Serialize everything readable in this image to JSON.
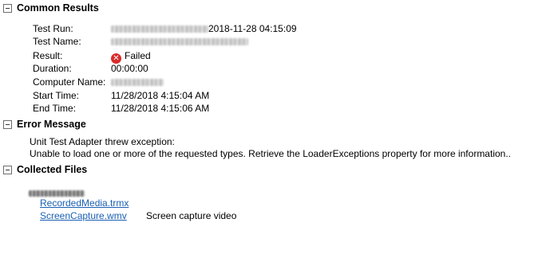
{
  "sections": {
    "common_results": "Common Results",
    "error_message": "Error Message",
    "collected_files": "Collected Files"
  },
  "common": {
    "test_run_label": "Test Run:",
    "test_run_timestamp": "2018-11-28 04:15:09",
    "test_name_label": "Test Name:",
    "result_label": "Result:",
    "result_value": "Failed",
    "duration_label": "Duration:",
    "duration_value": "00:00:00",
    "computer_name_label": "Computer Name:",
    "start_time_label": "Start Time:",
    "start_time_value": "11/28/2018 4:15:04 AM",
    "end_time_label": "End Time:",
    "end_time_value": "11/28/2018 4:15:06 AM"
  },
  "error": {
    "line1": "Unit Test Adapter threw exception:",
    "line2": "Unable to load one or more of the requested types. Retrieve the LoaderExceptions property for more information.."
  },
  "files": [
    {
      "name": "RecordedMedia.trmx",
      "description": ""
    },
    {
      "name": "ScreenCapture.wmv",
      "description": "Screen capture video"
    }
  ],
  "icons": {
    "collapse": "collapse-box-icon",
    "failed": "failed-x-icon"
  },
  "colors": {
    "link": "#1a5fb4",
    "failed": "#d92b2b"
  }
}
